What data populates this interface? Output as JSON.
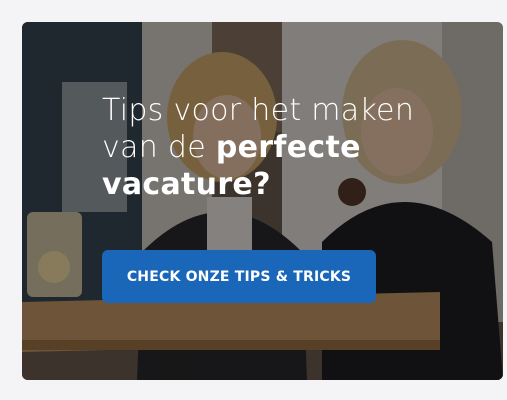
{
  "banner": {
    "headline_line1": "Tips voor het maken",
    "headline_line2_prefix": "van de",
    "headline_line2_emphasis": "perfecte",
    "headline_line3_emphasis": "vacature?",
    "cta_label": "CHECK ONZE TIPS & TRICKS"
  },
  "colors": {
    "cta_background": "#1a66b8",
    "headline_text": "#ffffff"
  }
}
